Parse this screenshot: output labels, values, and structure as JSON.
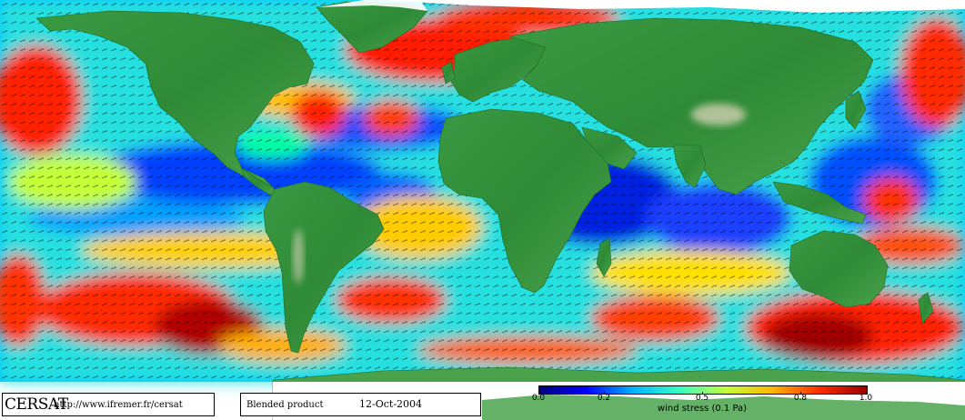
{
  "credit": {
    "logo_text": "CERSAT",
    "url": "http://www.ifremer.fr/cersat"
  },
  "product": {
    "label": "Blended product",
    "date": "12-Oct-2004"
  },
  "colorbar": {
    "title": "wind stress (0.1 Pa)",
    "ticks": [
      {
        "label": "0.0",
        "value": 0.0
      },
      {
        "label": "0.2",
        "value": 0.2
      },
      {
        "label": "0.5",
        "value": 0.5
      },
      {
        "label": "0.8",
        "value": 0.8
      },
      {
        "label": "1.0",
        "value": 1.0
      }
    ],
    "range": [
      0.0,
      1.0
    ],
    "colors": [
      "#00007f",
      "#0000ff",
      "#00b4ff",
      "#38ffc4",
      "#c4ff38",
      "#ffb400",
      "#ff2a00",
      "#9a0000"
    ]
  },
  "map": {
    "land_colors": [
      "#2e8b3a",
      "#3f9a45",
      "#62ad5e"
    ],
    "ice_color": "#ffffff",
    "desert_color": "#c9ccaa"
  }
}
